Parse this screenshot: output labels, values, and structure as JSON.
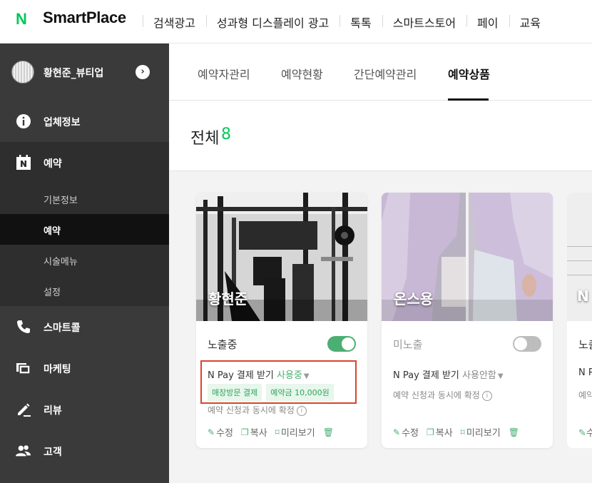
{
  "brand": {
    "logo_letter": "N",
    "name": "SmartPlace"
  },
  "top_nav": [
    "검색광고",
    "성과형 디스플레이 광고",
    "톡톡",
    "스마트스토어",
    "페이",
    "교육"
  ],
  "user": {
    "name": "황현준_뷰티업",
    "arrow": "›"
  },
  "sidebar": {
    "items": [
      {
        "label": "업체정보",
        "icon": "info-icon"
      },
      {
        "label": "예약",
        "icon": "naver-booking-icon"
      },
      {
        "label": "스마트콜",
        "icon": "phone-icon"
      },
      {
        "label": "마케팅",
        "icon": "marketing-icon"
      },
      {
        "label": "리뷰",
        "icon": "pencil-icon"
      },
      {
        "label": "고객",
        "icon": "customers-icon"
      }
    ],
    "submenu": [
      "기본정보",
      "예약",
      "시술메뉴",
      "설정"
    ],
    "active_submenu": "예약"
  },
  "tabs": [
    "예약자관리",
    "예약현황",
    "간단예약관리",
    "예약상품"
  ],
  "active_tab": "예약상품",
  "summary": {
    "label": "전체",
    "count": "8"
  },
  "cards": [
    {
      "title": "황현준",
      "status": "노출중",
      "toggle_on": true,
      "pay_label": "N Pay 결제 받기",
      "pay_state": "사용중",
      "badges": [
        "매장방문 결제",
        "예약금 10,000원"
      ],
      "confirm": "예약 신청과 동시에 확정",
      "actions": [
        "수정",
        "복사",
        "미리보기"
      ]
    },
    {
      "title": "온스용",
      "status": "미노출",
      "toggle_on": false,
      "pay_label": "N Pay 결제 받기",
      "pay_state": "사용안함",
      "badges": [],
      "confirm": "예약 신청과 동시에 확정",
      "actions": [
        "수정",
        "복사",
        "미리보기"
      ]
    },
    {
      "title": "N",
      "status": "노출",
      "pay_label": "N P",
      "confirm": "예약",
      "actions": [
        "수"
      ]
    }
  ],
  "colors": {
    "accent": "#03c75a",
    "sidebar": "#3a3a3a",
    "highlight": "#d9442c"
  }
}
